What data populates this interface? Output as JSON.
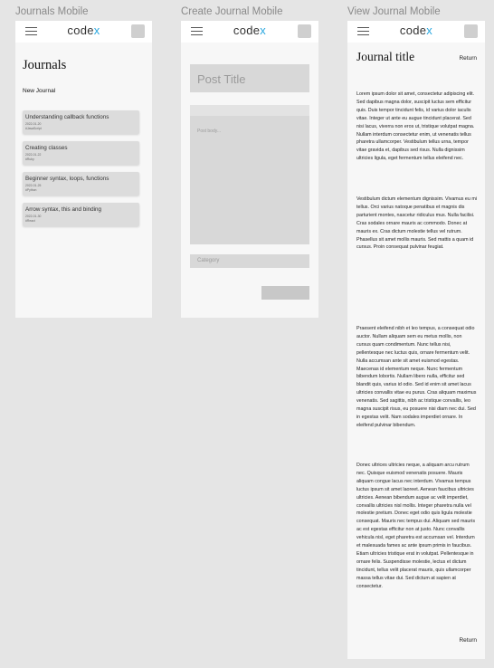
{
  "frames": {
    "journals": "Journals Mobile",
    "create": "Create Journal Mobile",
    "view": "View Journal Mobile"
  },
  "brand": {
    "logo_main": "code",
    "logo_accent": "x",
    "accent": "#2aa7df"
  },
  "journals_page": {
    "title": "Journals",
    "new_journal": "New Journal",
    "items": [
      {
        "title": "Understanding callback functions",
        "date": "2022-01-20",
        "tag": "#JavaScript"
      },
      {
        "title": "Creating classes",
        "date": "2022-01-22",
        "tag": "#Ruby"
      },
      {
        "title": "Beginner syntax, loops, functions",
        "date": "2022-01-25",
        "tag": "#Python"
      },
      {
        "title": "Arrow syntax, this and binding",
        "date": "2022-01-30",
        "tag": "#React"
      }
    ]
  },
  "create_page": {
    "title_placeholder": "Post Title",
    "body_placeholder": "Post body...",
    "category_placeholder": "Category"
  },
  "view_page": {
    "title": "Journal title",
    "return_label": "Return",
    "paragraphs": [
      "Lorem ipsum dolor sit amet, consectetur adipiscing elit. Sed dapibus magna dolor, suscipit luctus sem efficitur quis. Duis tempor tincidunt felis, id varius dolor iaculis vitae. Integer ut ante eu augue tincidunt placerat. Sed nisi lacus, viverra non eros ut, tristique volutpat magna. Nullam interdum consectetur enim, ut venenatis tellus pharetra ullamcorper. Vestibulum tellus urna, tempor vitae gravida et, dapibus sed risus. Nulla dignissim ultricies ligula, eget fermentum tellus eleifend nec.",
      "Vestibulum dictum elementum dignissim. Vivamus eu mi tellus. Orci varius natoque penatibus et magnis dis parturient montes, nascetur ridiculus mus. Nulla facilisi. Cras sodales ornare mauris ac commodo. Donec at mauris ex. Cras dictum molestie tellus vel rutrum. Phasellus sit amet mollis mauris. Sed mattis a quam id cursus. Proin consequat pulvinar feugiat.",
      "Praesent eleifend nibh et leo tempus, a consequat odio auctor. Nullam aliquam sem eu metus mollis, non cursus quam condimentum. Nunc tellus nisi, pellentesque nec luctus quis, ornare fermentum velit. Nulla accumsan ante sit amet euismod egestas. Maecenas id elementum neque. Nunc fermentum bibendum lobortis. Nullam libero nulla, efficitur sed blandit quis, varius id odio. Sed id enim sit amet lacus ultricies convallis vitae eu purus. Cras aliquam maximus venenatis. Sed sagittis, nibh ac tristique convallis, leo magna suscipit risus, eu posuere nisi diam nec dui. Sed in egestas velit. Nam sodales imperdiet ornare. In eleifend pulvinar bibendum.",
      "Donec ultrices ultricies neque, a aliquam arcu rutrum nec. Quisque euismod venenatis posuere. Mauris aliquam congue lacus nec interdum. Vivamus tempus luctus ipsum sit amet laoreet. Aenean faucibus ultricies ultricies. Aenean bibendum augue ac velit imperdiet, convallis ultricies nisl mollis. Integer pharetra nulla vel molestie pretium. Donec eget odio quis ligula molestie consequat. Mauris nec tempus dui. Aliquam sed mauris ac est egestas efficitur non at justo. Nunc convallis vehicula nisl, eget pharetra est accumsan vel. Interdum et malesuada fames ac ante ipsum primis in faucibus. Etiam ultricies tristique erat in volutpat. Pellentesque in ornare felis. Suspendisse molestie, lectus et dictum tincidunt, tellus velit placerat mauris, quis ullamcorper massa tellus vitae dui. Sed dictum at sapien at consectetur."
    ]
  }
}
